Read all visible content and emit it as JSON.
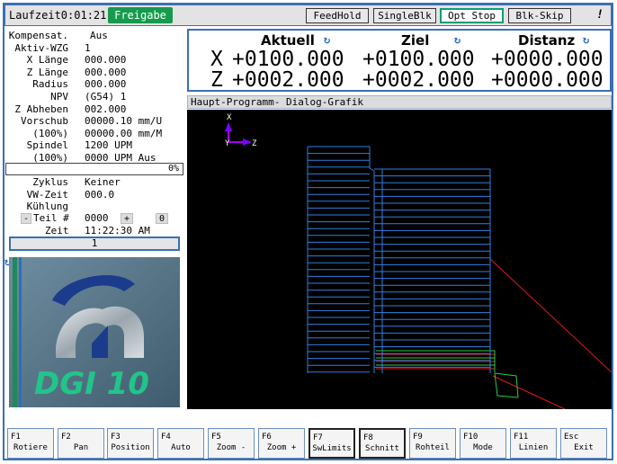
{
  "topbar": {
    "laufzeit": "Laufzeit0:01:21",
    "freigabe": "Freigabe",
    "buttons": [
      "FeedHold",
      "SingleBlk",
      "Opt Stop",
      "Blk-Skip"
    ],
    "mark": "!"
  },
  "left": {
    "rows": [
      {
        "label": "Kompensat.",
        "value": "Aus"
      },
      {
        "label": "Aktiv-WZG",
        "value": "1"
      },
      {
        "label": "X Länge",
        "value": "000.000"
      },
      {
        "label": "Z Länge",
        "value": "000.000"
      },
      {
        "label": "Radius",
        "value": "000.000"
      },
      {
        "label": "NPV",
        "value": "(G54) 1"
      },
      {
        "label": "Z Abheben",
        "value": "002.000"
      },
      {
        "label": "Vorschub",
        "value": "00000.10 mm/U"
      },
      {
        "label": "(100%)",
        "value": "00000.00 mm/M"
      },
      {
        "label": "Spindel",
        "value": "1200 UPM"
      },
      {
        "label": "(100%)",
        "value": "0000 UPM Aus"
      }
    ],
    "progress": "0%",
    "rows2": [
      {
        "label": "Zyklus",
        "value": "Keiner"
      },
      {
        "label": "VW-Zeit",
        "value": "000.0"
      },
      {
        "label": "Kühlung",
        "value": ""
      }
    ],
    "teil_label": "Teil #",
    "teil_value": "0000",
    "teil_minus": "-",
    "teil_plus": "+",
    "teil_zero": "0",
    "zeit_label": "Zeit",
    "zeit_value": "11:22:30 AM",
    "cycle_value": "1",
    "logo_text": "DGI 10"
  },
  "dro": {
    "headers": [
      "Aktuell",
      "Ziel",
      "Distanz"
    ],
    "x_label": "X",
    "z_label": "Z",
    "x_values": [
      "+0100.000",
      "+0100.000",
      "+0000.000"
    ],
    "z_values": [
      "+0002.000",
      "+0002.000",
      "+0000.000"
    ]
  },
  "tabs": {
    "text": "Haupt-Programm-  Dialog-Grafik"
  },
  "graphic": {
    "axis_x": "X",
    "axis_z": "Z"
  },
  "fkeys": [
    {
      "key": "F1",
      "label": "Rotiere"
    },
    {
      "key": "F2",
      "label": "Pan"
    },
    {
      "key": "F3",
      "label": "Position"
    },
    {
      "key": "F4",
      "label": "Auto"
    },
    {
      "key": "F5",
      "label": "Zoom -"
    },
    {
      "key": "F6",
      "label": "Zoom +"
    },
    {
      "key": "F7",
      "label": "SwLimits"
    },
    {
      "key": "F8",
      "label": "Schnitt"
    },
    {
      "key": "F9",
      "label": "Rohteil"
    },
    {
      "key": "F10",
      "label": "Mode"
    },
    {
      "key": "F11",
      "label": "Linien"
    },
    {
      "key": "Esc",
      "label": "Exit"
    }
  ],
  "colors": {
    "accent_blue": "#3b6fb6",
    "freigabe_green": "#169b4e",
    "toolpath_blue": "#2f7fe0",
    "toolpath_red": "#e01b1b",
    "toolpath_green": "#2ecc40"
  }
}
